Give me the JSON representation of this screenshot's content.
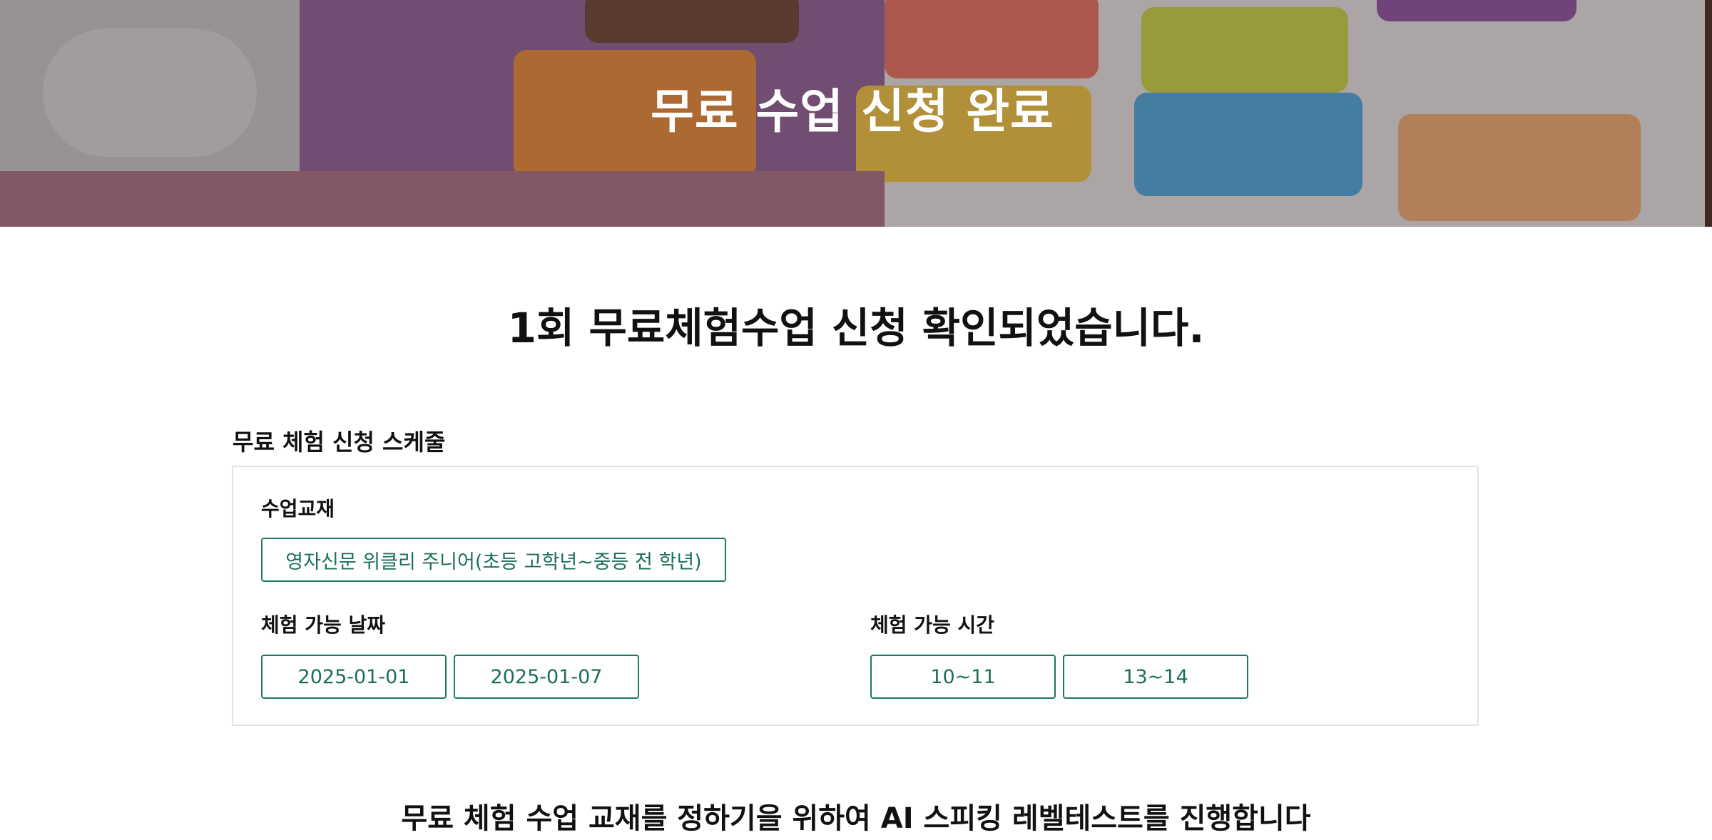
{
  "hero": {
    "title": "무료 수업 신청 완료"
  },
  "main": {
    "confirm_title": "1회 무료체험수업 신청 확인되었습니다.",
    "schedule_section_label": "무료 체험 신청 스케줄",
    "textbook": {
      "label": "수업교재",
      "value": "영자신문 위클리 주니어(초등 고학년~중등 전 학년)"
    },
    "dates": {
      "label": "체험 가능 날짜",
      "values": [
        "2025-01-01",
        "2025-01-07"
      ]
    },
    "times": {
      "label": "체험 가능 시간",
      "values": [
        "10~11",
        "13~14"
      ]
    },
    "bottom_notice": "무료 체험 수업 교재를 정하기을 위하여 AI 스피킹 레벨테스트를 진행합니다"
  },
  "colors": {
    "accent": "#1a7a64",
    "box_border": "#e3e3e3"
  }
}
